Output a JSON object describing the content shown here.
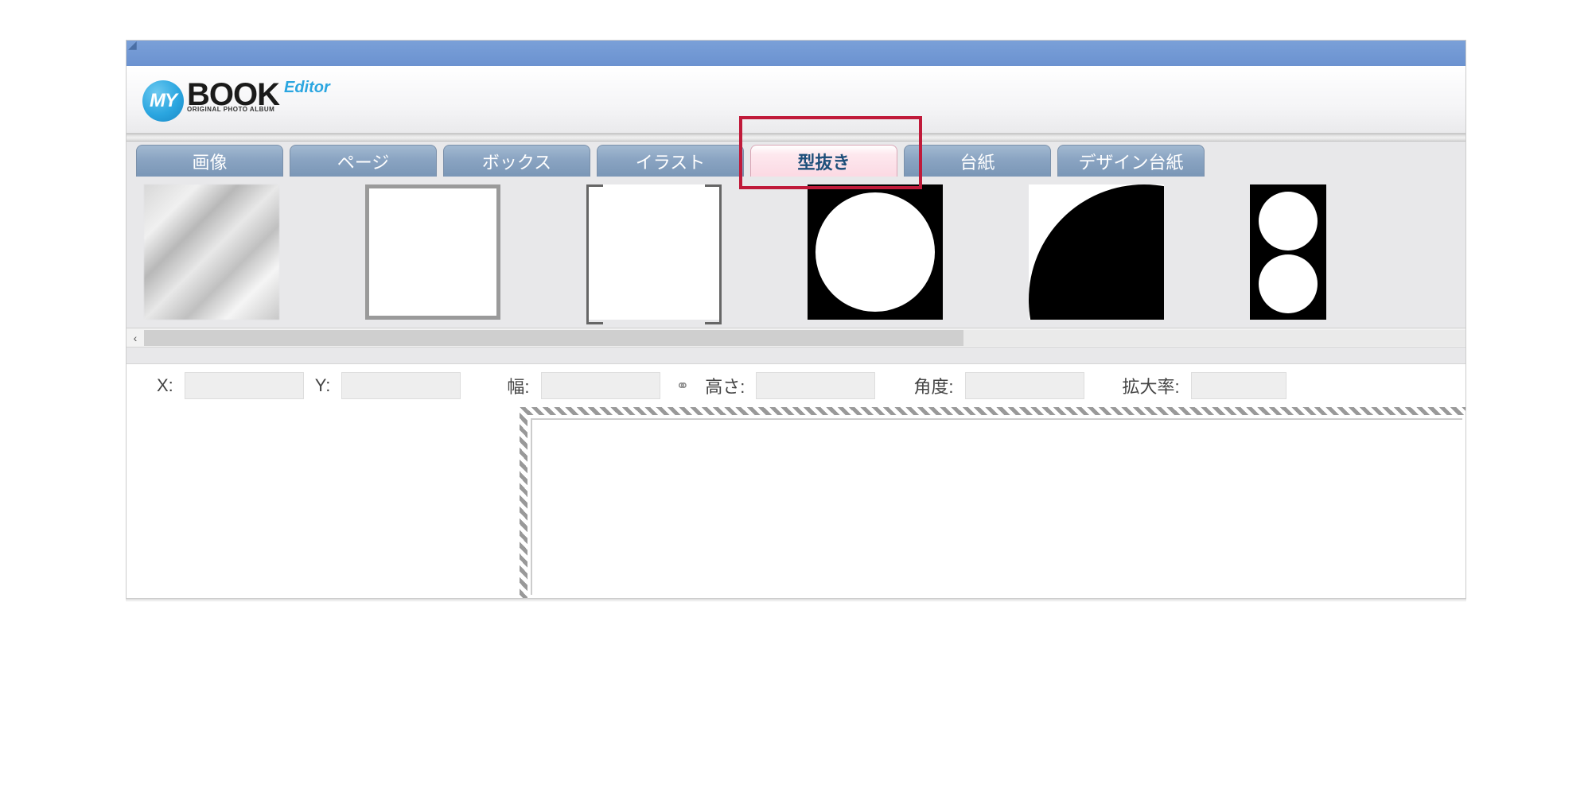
{
  "app": {
    "logo_my": "MY",
    "logo_book": "BOOK",
    "logo_editor": "Editor",
    "logo_sub": "ORIGINAL PHOTO ALBUM"
  },
  "tabs": [
    {
      "label": "画像",
      "active": false
    },
    {
      "label": "ページ",
      "active": false
    },
    {
      "label": "ボックス",
      "active": false
    },
    {
      "label": "イラスト",
      "active": false
    },
    {
      "label": "型抜き",
      "active": true
    },
    {
      "label": "台紙",
      "active": false
    },
    {
      "label": "デザイン台紙",
      "active": false
    }
  ],
  "thumbnails": [
    {
      "name": "cloud-texture"
    },
    {
      "name": "square-frame"
    },
    {
      "name": "bracket-frame"
    },
    {
      "name": "circle-mask"
    },
    {
      "name": "curve-mask"
    },
    {
      "name": "two-circles-mask"
    }
  ],
  "scroll": {
    "left_arrow": "‹"
  },
  "properties": {
    "x_label": "X:",
    "x_value": "",
    "y_label": "Y:",
    "y_value": "",
    "width_label": "幅:",
    "width_value": "",
    "height_label": "高さ:",
    "height_value": "",
    "angle_label": "角度:",
    "angle_value": "",
    "scale_label": "拡大率:",
    "scale_value": "",
    "link_icon": "⚭"
  },
  "colors": {
    "titlebar": "#6b92d0",
    "tab_inactive": "#8aa4c2",
    "tab_active": "#fcd9e3",
    "highlight": "#c01a3a",
    "accent": "#2ba6e0"
  }
}
